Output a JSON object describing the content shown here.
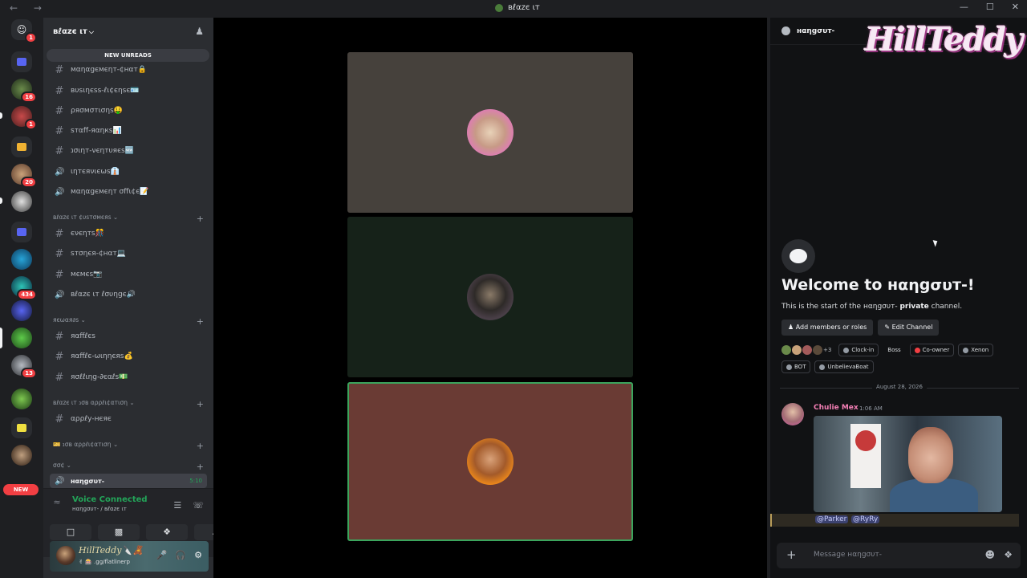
{
  "window": {
    "title": "вℓαzє ιт",
    "nav_glyphs": "← →",
    "controls": [
      "—",
      "☐",
      "✕"
    ]
  },
  "rail": {
    "badges": [
      "1",
      "16",
      "1",
      "20",
      "434",
      "13"
    ],
    "new_label": "NEW"
  },
  "sidebar": {
    "guild_name": "вℓαzє ιт",
    "new_unreads": "NEW UNREADS",
    "channels_top": [
      {
        "type": "text",
        "label": "мαηαgємєηт-¢нαт🔒"
      },
      {
        "type": "text",
        "label": "вυѕιηєѕѕ-ℓι¢єηѕє🪪"
      },
      {
        "type": "text",
        "label": "ρяσмσтισηѕ🤑"
      },
      {
        "type": "text",
        "label": "ѕтαff-яαηкѕ📊"
      },
      {
        "type": "text",
        "label": "נσιηт-νєηтυяєѕ🆕"
      },
      {
        "type": "voice",
        "label": "ιηтєяνιєωѕ👔"
      },
      {
        "type": "voice",
        "label": "мαηαgємєηт σffι¢є📝"
      }
    ],
    "category_customers": "вℓαzє ιт ¢υѕтσмєяѕ",
    "channels_customers": [
      {
        "type": "text",
        "label": "єνєηтѕ🎊"
      },
      {
        "type": "text",
        "label": "ѕтσηєя-¢нαт💻"
      },
      {
        "type": "text",
        "label": "мємєѕ📷"
      },
      {
        "type": "voice",
        "label": "вℓαzє ιт ℓσυηgє🔊"
      }
    ],
    "category_rewards": "яєωαя∂ѕ",
    "channels_rewards": [
      {
        "type": "text",
        "label": "яαffℓєѕ"
      },
      {
        "type": "text",
        "label": "яαffℓє-ωιηηєяѕ💰"
      },
      {
        "type": "text",
        "label": "яσℓℓιηg-∂єαℓѕ💵"
      }
    ],
    "category_job": "вℓαzє ιт נσв αρρℓι¢αтιση",
    "channels_job": [
      {
        "type": "text",
        "label": "αρρℓу-нєяє"
      }
    ],
    "category_job2": "🎫 נσв αρρℓι¢αтιση",
    "category_oot": "σσ¢",
    "active_channel": {
      "label": "нαηgσυт-",
      "time": "5:10"
    },
    "voice_panel": {
      "status": "Voice Connected",
      "sub": "нαηgσυт- / вℓαzє ιт"
    },
    "user": {
      "name": "HillTeddy🔪🧸",
      "sub": "✌ 🎰 .gg/flatlinerp"
    }
  },
  "chat": {
    "header": "нαηgσυт-",
    "watermark": "HillTeddy",
    "welcome_title": "Welcome to нαηgσυт-!",
    "welcome_pre": "This is the start of the ",
    "welcome_channel": "нαηgσυт-",
    "welcome_private": "private",
    "welcome_post": " channel.",
    "actions": [
      "Add members or roles",
      "Edit Channel"
    ],
    "member_extra": "+3",
    "roles": [
      {
        "name": "Clock-in",
        "color": "#949ba4"
      },
      {
        "name": "Boss",
        "color": ""
      },
      {
        "name": "Co-owner",
        "color": "#f23f43"
      },
      {
        "name": "Xenon",
        "color": "#949ba4"
      },
      {
        "name": "BOT",
        "color": "#949ba4"
      },
      {
        "name": "UnbelievaBoat",
        "color": "#949ba4"
      }
    ],
    "date": "August 28, 2026",
    "message": {
      "author": "Chulie Mex",
      "time": "1:06 AM",
      "mentions": [
        "@Parker",
        "@RyRy"
      ]
    },
    "composer_placeholder": "Message нαηgσυт-"
  }
}
